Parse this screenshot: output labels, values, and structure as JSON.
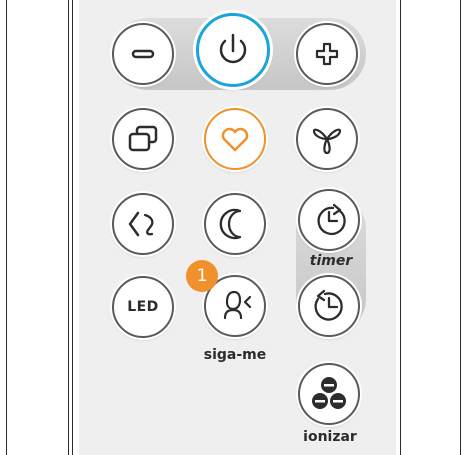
{
  "controls": {
    "led_label": "LED",
    "timer_label": "timer",
    "follow_me_label": "siga-me",
    "ionizer_label": "ionizar",
    "badge_number": "1"
  },
  "colors": {
    "accent": "#f0912c",
    "power": "#1aa3dc",
    "outline": "#5a5a5a"
  },
  "icons": [
    "minus-icon",
    "power-icon",
    "plus-icon",
    "windows-icon",
    "heart-icon",
    "fan-icon",
    "swing-icon",
    "moon-icon",
    "timer-on-icon",
    "led-icon",
    "follow-me-icon",
    "timer-off-icon",
    "ionizer-icon"
  ]
}
